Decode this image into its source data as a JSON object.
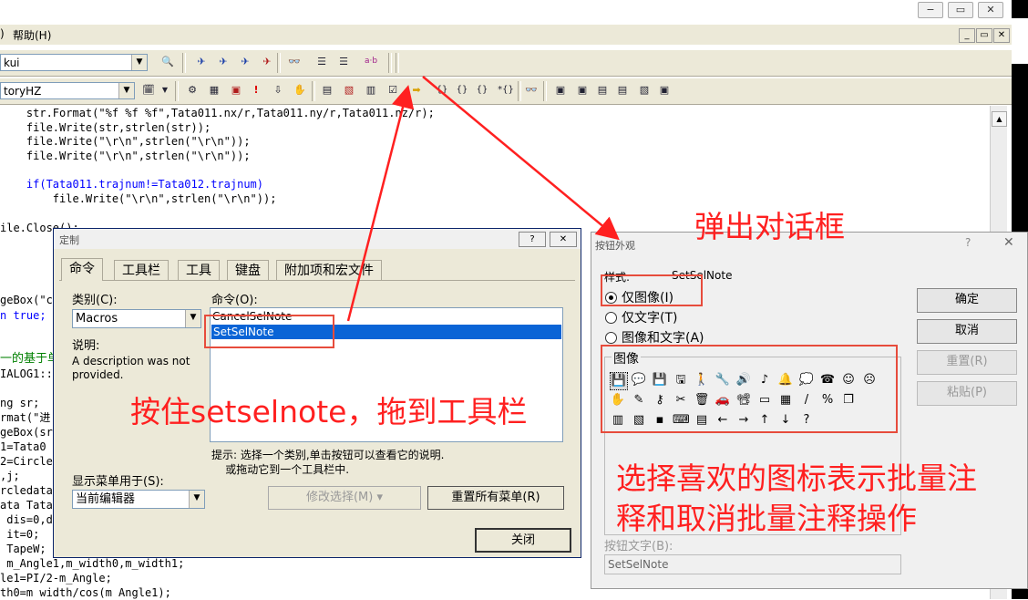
{
  "menubar": {
    "left_fragment": ")",
    "help": "帮助(H)"
  },
  "toolbar": {
    "combo1": "kui",
    "combo2": "toryHZ"
  },
  "window_controls": {
    "minimize": "−",
    "restore": "▭",
    "close": "✕"
  },
  "code_lines": [
    {
      "indent": "    ",
      "text": "str.Format(\"%f %f %f\",Tata011.nx/r,Tata011.ny/r,Tata011.nz/r);"
    },
    {
      "indent": "    ",
      "text": "file.Write(str,strlen(str));"
    },
    {
      "indent": "    ",
      "text": "file.Write(\"\\r\\n\",strlen(\"\\r\\n\"));"
    },
    {
      "indent": "    ",
      "text": "file.Write(\"\\r\\n\",strlen(\"\\r\\n\"));"
    },
    {
      "indent": "",
      "text": ""
    },
    {
      "indent": "    ",
      "text": "if(Tata011.trajnum!=Tata012.trajnum)"
    },
    {
      "indent": "        ",
      "text": "file.Write(\"\\r\\n\",strlen(\"\\r\\n\"));"
    },
    {
      "indent": "",
      "text": ""
    },
    {
      "indent": "",
      "text": "ile.Close();"
    }
  ],
  "left_code_fragments": [
    "geBox(\"c",
    "n true;",
    "",
    "一的基于单",
    "IALOG1::",
    "",
    "ng sr;",
    "rmat(\"进",
    "geBox(sr",
    "1=Tata0",
    "2=Circle",
    ",j;",
    "rcledata",
    "ata Tata",
    " dis=0,d",
    " it=0;",
    " TapeW;",
    " m_Angle1,m_width0,m_width1;",
    "le1=PI/2-m_Angle;",
    "th0=m width/cos(m Angle1);"
  ],
  "customize_dialog": {
    "title": "定制",
    "tabs": [
      "命令",
      "工具栏",
      "工具",
      "键盘",
      "附加项和宏文件"
    ],
    "category_label": "类别(C):",
    "category_value": "Macros",
    "commands_label": "命令(O):",
    "commands": [
      "CancelSelNote",
      "SetSelNote"
    ],
    "selected_command": "SetSelNote",
    "description_label": "说明:",
    "description_text": "A description was not provided.",
    "hint": "提示: 选择一个类别,单击按钮可以查看它的说明.\n    或拖动它到一个工具栏中.",
    "show_menu_label": "显示菜单用于(S):",
    "show_menu_value": "当前编辑器",
    "modify_button": "修改选择(M) ▾",
    "reset_menus_button": "重置所有菜单(R)",
    "close_button": "关闭"
  },
  "appearance_dialog": {
    "title": "按钮外观",
    "style_label": "样式:",
    "style_value": "SetSelNote",
    "options": [
      "仅图像(I)",
      "仅文字(T)",
      "图像和文字(A)"
    ],
    "images_label": "图像",
    "icons": [
      [
        "💾",
        "💬",
        "💾",
        "🖫",
        "🚶",
        "🔧",
        "🔊",
        "♪",
        "🔔",
        "💭",
        "☎",
        "☺",
        "☹"
      ],
      [
        "✋",
        "✎",
        "⚷",
        "✂",
        "🗑",
        "🚗",
        "📽",
        "▭",
        "▦",
        "/",
        "%",
        "❐"
      ],
      [
        "▥",
        "▧",
        "▪",
        "⌨",
        "▤",
        "←",
        "→",
        "↑",
        "↓",
        "?"
      ]
    ],
    "ok_button": "确定",
    "cancel_button": "取消",
    "reset_button": "重置(R)",
    "paste_button": "粘贴(P)",
    "button_text_label": "按钮文字(B):",
    "button_text_value": "SetSelNote"
  },
  "annotations": {
    "popup": "弹出对话框",
    "drag": "按住setselnote，拖到工具栏",
    "choose1": "选择喜欢的图标表示批量注",
    "choose2": "释和取消批量注释操作"
  },
  "colors": {
    "annotation": "#ff2020",
    "selection": "#0a64d6",
    "keyword": "#0000ff"
  }
}
